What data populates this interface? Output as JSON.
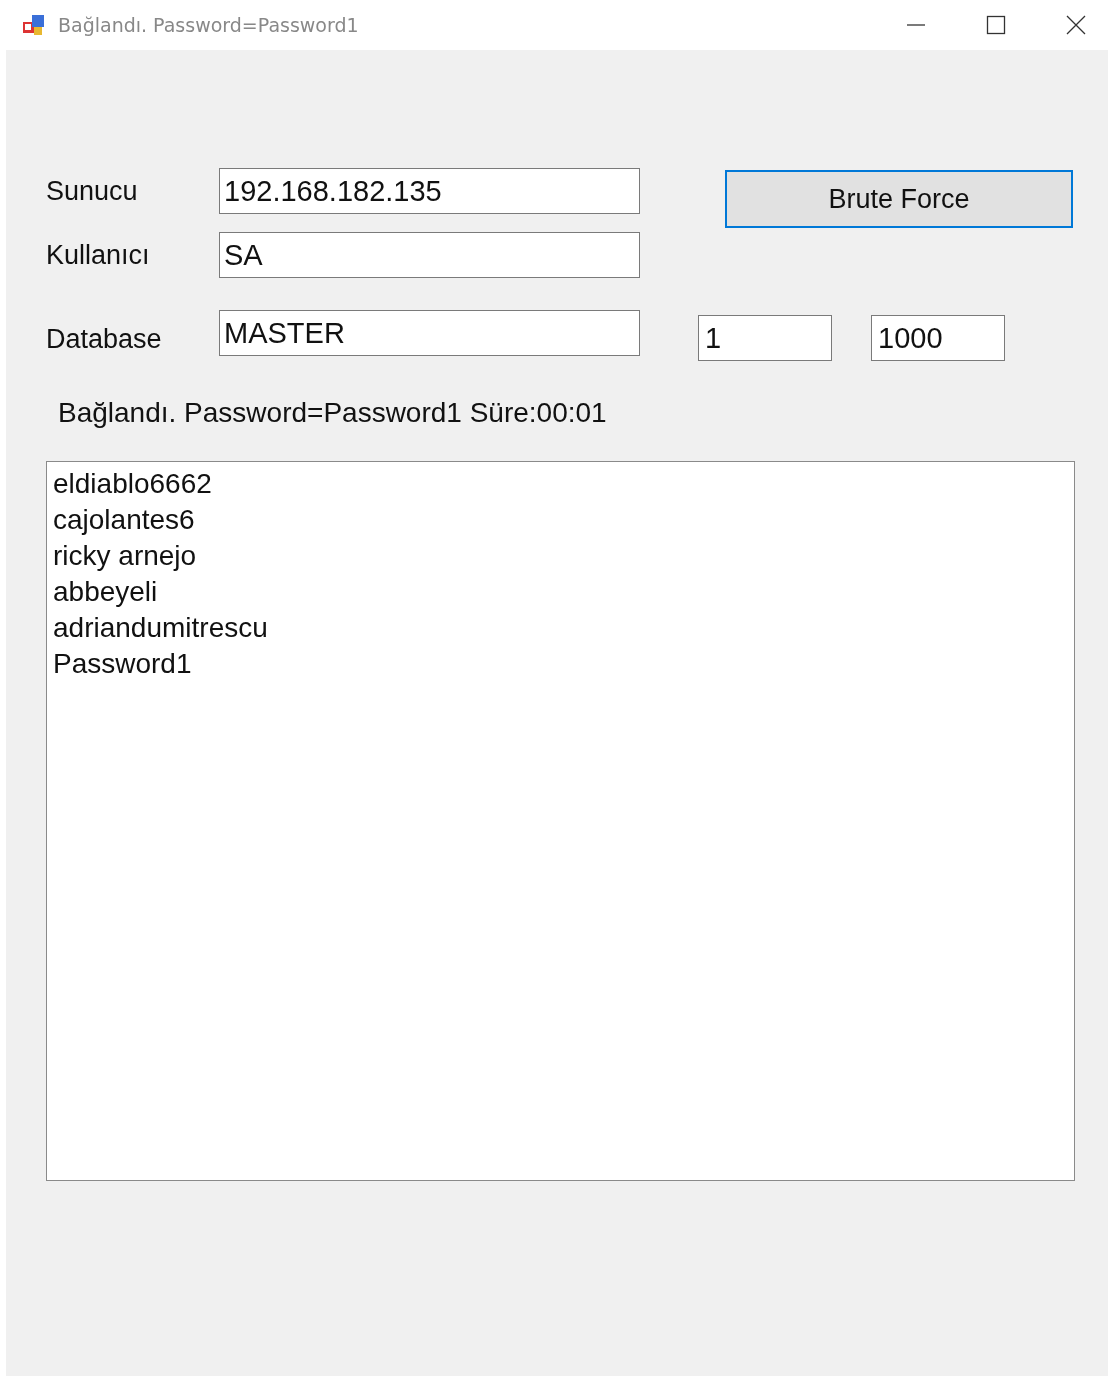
{
  "window": {
    "title": "Bağlandı. Password=Password1"
  },
  "fields": [
    {
      "label": "Sunucu",
      "value": "192.168.182.135"
    },
    {
      "label": "Kullanıcı",
      "value": "SA"
    },
    {
      "label": "Database",
      "value": "MASTER"
    }
  ],
  "button": {
    "label": "Brute Force"
  },
  "range": {
    "from": "1",
    "to": "1000"
  },
  "status": "Bağlandı. Password=Password1 Süre:00:01",
  "list": [
    "eldiablo6662",
    "cajolantes6",
    "ricky arnejo",
    "abbeyeli",
    "adriandumitrescu",
    "Password1"
  ]
}
